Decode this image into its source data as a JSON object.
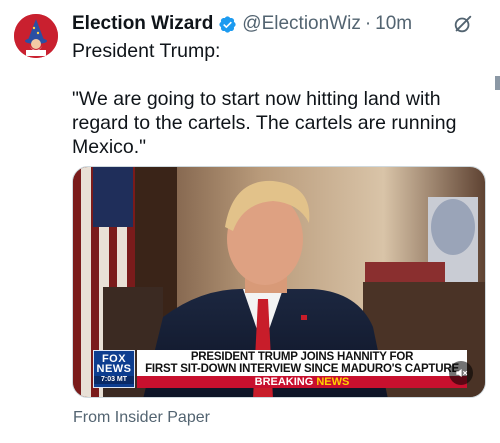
{
  "post": {
    "author_name": "Election Wizard",
    "handle": "@ElectionWiz",
    "separator": "·",
    "time": "10m",
    "verified": true,
    "text_line_1": "President Trump:",
    "text_quote": "\"We are going to start now hitting land with regard to the cartels. The cartels are running Mexico.\""
  },
  "media": {
    "network_logo_line_1": "FOX",
    "network_logo_line_2": "NEWS",
    "network_time": "7:03 MT",
    "headline_line_1": "PRESIDENT TRUMP JOINS HANNITY FOR",
    "headline_line_2": "FIRST SIT-DOWN INTERVIEW SINCE MADURO'S CAPTURE",
    "breaking_label": "BREAKING",
    "breaking_news": "NEWS"
  },
  "footer": {
    "source": "From Insider Paper"
  },
  "colors": {
    "verified_badge": "#1d9bf0",
    "avatar_bg": "#c9202f",
    "muted_text": "#536471",
    "chyron_red": "#c8102e",
    "fox_blue": "#0d3d8f"
  },
  "icons": {
    "avatar": "wizard-avatar",
    "verified": "verified-badge-icon",
    "grok": "grok-icon",
    "mute": "mute-icon"
  }
}
